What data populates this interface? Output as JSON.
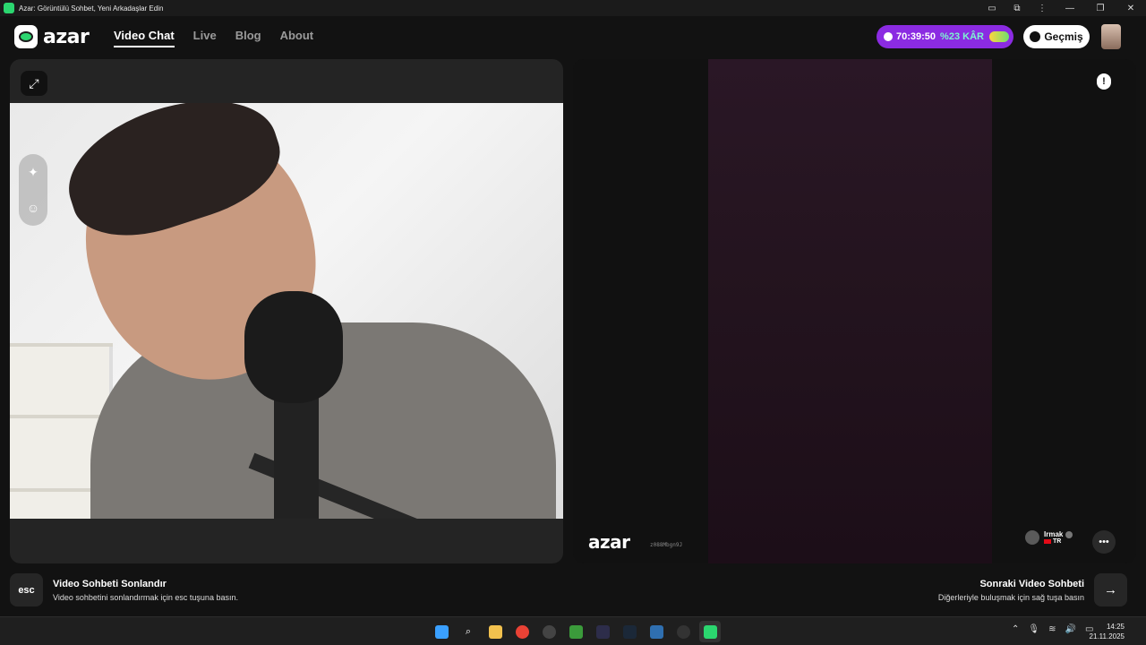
{
  "window": {
    "title": "Azar: Görüntülü Sohbet, Yeni Arkadaşlar Edin",
    "controls": [
      "minimize",
      "restore",
      "close"
    ]
  },
  "header": {
    "logo_text": "azar",
    "nav": [
      {
        "label": "Video Chat",
        "active": true
      },
      {
        "label": "Live",
        "active": false
      },
      {
        "label": "Blog",
        "active": false
      },
      {
        "label": "About",
        "active": false
      }
    ],
    "promo": {
      "time": "70:39:50",
      "discount": "%23 KÂR"
    },
    "history_label": "Geçmiş"
  },
  "remote": {
    "watermark_logo": "azar",
    "watermark_code": "z088Mbgn9J",
    "peer_name": "Irmak",
    "peer_country": "TR"
  },
  "footer": {
    "esc_key": "esc",
    "end_title": "Video Sohbeti Sonlandır",
    "end_sub": "Video sohbetini sonlandırmak için esc tuşuna basın.",
    "next_title": "Sonraki Video Sohbeti",
    "next_sub": "Diğerleriyle buluşmak için sağ tuşa basın",
    "next_icon": "→"
  },
  "taskbar": {
    "time": "14:25",
    "date": "21.11.2025"
  },
  "colors": {
    "accent_green": "#2bd66f",
    "promo_purple": "#8b2be2",
    "promo_teal": "#7df5d0"
  }
}
